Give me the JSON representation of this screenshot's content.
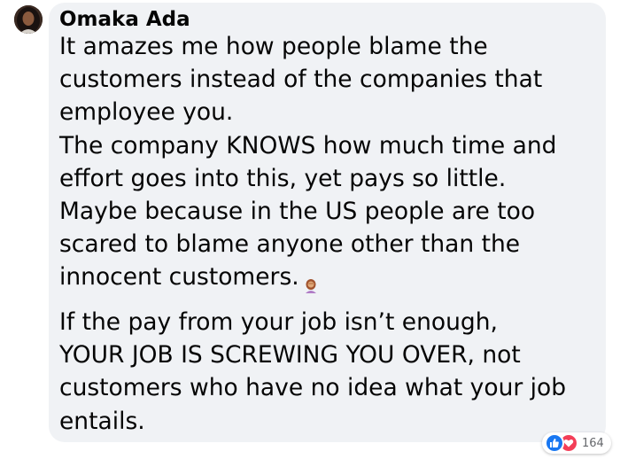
{
  "comment": {
    "author": "Omaka Ada",
    "paragraph1": [
      "It amazes me how people blame the",
      "customers instead of the companies that",
      "employee you.",
      "The company KNOWS how much time and",
      "effort goes into this, yet pays so little.",
      "Maybe because in the US people are too",
      "scared to blame anyone other than the",
      "innocent customers."
    ],
    "emoji": "woman-facepalming-emoji",
    "paragraph2": [
      "If the pay from your job isn’t enough,",
      "YOUR JOB IS SCREWING YOU OVER, not",
      "customers who have no idea what your job",
      "entails."
    ],
    "reactions": {
      "icons": [
        "like-icon",
        "love-icon"
      ],
      "count": "164",
      "colors": {
        "like": "#1877f2",
        "love": "#f33e58"
      }
    }
  }
}
